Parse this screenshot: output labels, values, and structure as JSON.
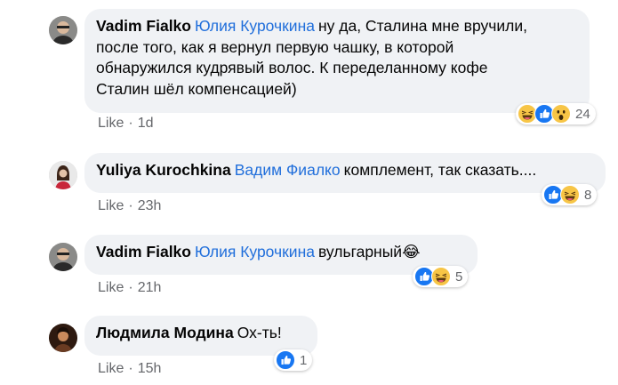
{
  "comments": [
    {
      "author": "Vadim Fialko",
      "mention": "Юлия Курочкина",
      "lines": [
        "ну да, Сталина мне вручили,",
        "после того, как я вернул первую чашку, в которой",
        "обнаружился кудрявый волос. К переделанному кофе",
        "Сталин шёл компенсацией)"
      ],
      "like": "Like",
      "time": "1d",
      "reactions": [
        "haha",
        "like",
        "wow"
      ],
      "reaction_count": "24"
    },
    {
      "author": "Yuliya Kurochkina",
      "mention": "Вадим Фиалко",
      "text": "комплемент, так сказать....",
      "like": "Like",
      "time": "23h",
      "reactions": [
        "like",
        "haha"
      ],
      "reaction_count": "8"
    },
    {
      "author": "Vadim Fialko",
      "mention": "Юлия Курочкина",
      "text": "вульгарный😂",
      "like": "Like",
      "time": "21h",
      "reactions": [
        "like",
        "haha"
      ],
      "reaction_count": "5"
    },
    {
      "author": "Людмила Модина",
      "mention": "",
      "text": "Ох-ть!",
      "like": "Like",
      "time": "15h",
      "reactions": [
        "like"
      ],
      "reaction_count": "1"
    }
  ],
  "colors": {
    "bubble": "#f0f2f5",
    "mention": "#216fdb",
    "meta": "#65676b",
    "like_reaction": "#1877f2"
  }
}
